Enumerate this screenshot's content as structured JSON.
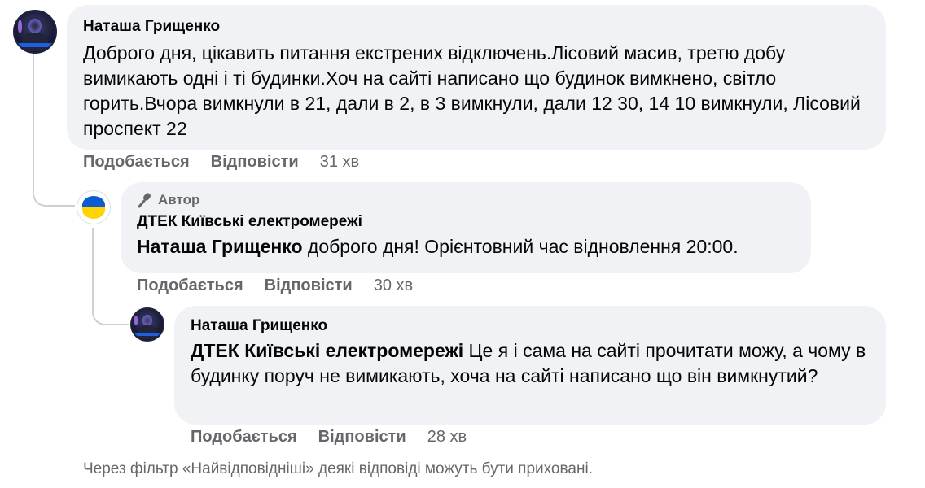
{
  "comments": [
    {
      "author": "Наташа Грищенко",
      "text": "Доброго дня, цікавить питання екстрених відключень.Лісовий масив, третю добу вимикають одні і ті будинки.Хоч на сайті написано що будинок вимкнено, світло горить.Вчора вимкнули в 21, дали в 2, в 3 вимкнули, дали 12 30, 14 10 вимкнули, Лісовий проспект 22",
      "like_label": "Подобається",
      "reply_label": "Відповісти",
      "time": "31 хв"
    },
    {
      "badge": "Автор",
      "author": "ДТЕК Київські електромережі",
      "mention": "Наташа Грищенко",
      "text": " доброго дня! Орієнтовний час відновлення 20:00.",
      "like_label": "Подобається",
      "reply_label": "Відповісти",
      "time": "30 хв"
    },
    {
      "author": "Наташа Грищенко",
      "mention": "ДТЕК Київські електромережі",
      "text": " Це я і сама на сайті прочитати можу, а чому в будинку поруч не вимикають, хоча на сайті написано що він вимкнутий?",
      "like_label": "Подобається",
      "reply_label": "Відповісти",
      "time": "28 хв"
    }
  ],
  "filter_notice": "Через фільтр «Найвідповідніші» деякі відповіді можуть бути приховані."
}
